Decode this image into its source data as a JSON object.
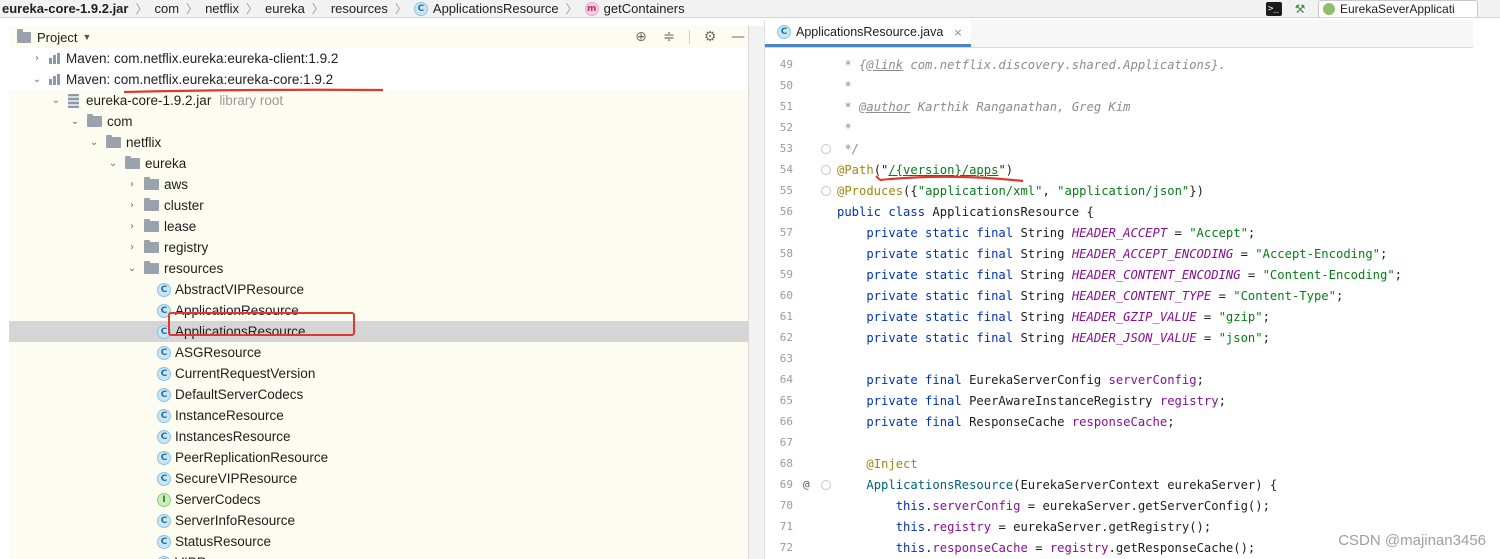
{
  "breadcrumb": [
    {
      "label": "eureka-core-1.9.2.jar",
      "icon": ""
    },
    {
      "label": "com",
      "icon": ""
    },
    {
      "label": "netflix",
      "icon": ""
    },
    {
      "label": "eureka",
      "icon": ""
    },
    {
      "label": "resources",
      "icon": ""
    },
    {
      "label": "ApplicationsResource",
      "icon": "class-icon"
    },
    {
      "label": "getContainers",
      "icon": "method-icon"
    }
  ],
  "toolbar": {
    "run_config": "EurekaSeverApplicati",
    "terminal_glyph": ">_",
    "build_glyph": "⚒"
  },
  "project_panel": {
    "title": "Project",
    "tools": [
      "target-icon",
      "collapse-icon",
      "gear-icon",
      "minimize-icon"
    ],
    "tree": [
      {
        "label": "Maven: com.netflix.eureka:eureka-client:1.9.2",
        "icon": "maven",
        "arrow": "›",
        "level": 1
      },
      {
        "label": "Maven: com.netflix.eureka:eureka-core:1.9.2",
        "icon": "maven",
        "arrow": "⌄",
        "level": 1
      },
      {
        "label": "eureka-core-1.9.2.jar",
        "suffix": "library root",
        "icon": "jar",
        "arrow": "⌄",
        "level": 2
      },
      {
        "label": "com",
        "icon": "folder",
        "arrow": "⌄",
        "level": 3
      },
      {
        "label": "netflix",
        "icon": "folder",
        "arrow": "⌄",
        "level": 4
      },
      {
        "label": "eureka",
        "icon": "folder",
        "arrow": "⌄",
        "level": 5
      },
      {
        "label": "aws",
        "icon": "folder",
        "arrow": "›",
        "level": 6
      },
      {
        "label": "cluster",
        "icon": "folder",
        "arrow": "›",
        "level": 6
      },
      {
        "label": "lease",
        "icon": "folder",
        "arrow": "›",
        "level": 6
      },
      {
        "label": "registry",
        "icon": "folder",
        "arrow": "›",
        "level": 6
      },
      {
        "label": "resources",
        "icon": "folder",
        "arrow": "⌄",
        "level": 6
      },
      {
        "label": "AbstractVIPResource",
        "icon": "class",
        "level": 7
      },
      {
        "label": "ApplicationResource",
        "icon": "class",
        "level": 7
      },
      {
        "label": "ApplicationsResource",
        "icon": "class",
        "level": 7,
        "selected": true
      },
      {
        "label": "ASGResource",
        "icon": "class",
        "level": 7
      },
      {
        "label": "CurrentRequestVersion",
        "icon": "class",
        "level": 7
      },
      {
        "label": "DefaultServerCodecs",
        "icon": "class",
        "level": 7
      },
      {
        "label": "InstanceResource",
        "icon": "class",
        "level": 7
      },
      {
        "label": "InstancesResource",
        "icon": "class",
        "level": 7
      },
      {
        "label": "PeerReplicationResource",
        "icon": "class",
        "level": 7
      },
      {
        "label": "SecureVIPResource",
        "icon": "class",
        "level": 7
      },
      {
        "label": "ServerCodecs",
        "icon": "interface",
        "level": 7
      },
      {
        "label": "ServerInfoResource",
        "icon": "class",
        "level": 7
      },
      {
        "label": "StatusResource",
        "icon": "class",
        "level": 7
      },
      {
        "label": "VIPResource",
        "icon": "class",
        "level": 7
      }
    ]
  },
  "editor": {
    "tab": {
      "label": "ApplicationsResource.java",
      "close": "×"
    },
    "lines": [
      {
        "n": "49",
        "tokens": [
          [
            " * ",
            "cmt"
          ],
          [
            "{",
            "cmt"
          ],
          [
            "@link",
            "doctag"
          ],
          [
            " com.netflix.discovery.shared.Applications}.",
            "cmt"
          ]
        ]
      },
      {
        "n": "50",
        "tokens": [
          [
            " *",
            "cmt"
          ]
        ]
      },
      {
        "n": "51",
        "tokens": [
          [
            " * ",
            "cmt"
          ],
          [
            "@author",
            "doctag"
          ],
          [
            " Karthik Ranganathan, Greg Kim",
            "cmt"
          ]
        ]
      },
      {
        "n": "52",
        "tokens": [
          [
            " *",
            "cmt"
          ]
        ]
      },
      {
        "n": "53",
        "tokens": [
          [
            " */",
            "cmt"
          ]
        ],
        "fold": true
      },
      {
        "n": "54",
        "tokens": [
          [
            "@Path",
            "ann"
          ],
          [
            "(\"",
            "ty"
          ],
          [
            "/{version}/apps",
            "pth"
          ],
          [
            "\")",
            "ty"
          ]
        ],
        "fold": true
      },
      {
        "n": "55",
        "tokens": [
          [
            "@Produces",
            "ann"
          ],
          [
            "({",
            "ty"
          ],
          [
            "\"application/xml\"",
            "str"
          ],
          [
            ", ",
            "ty"
          ],
          [
            "\"application/json\"",
            "str"
          ],
          [
            "})",
            "ty"
          ]
        ],
        "fold": true
      },
      {
        "n": "56",
        "tokens": [
          [
            "public class ",
            "kw"
          ],
          [
            "ApplicationsResource {",
            "ty"
          ]
        ]
      },
      {
        "n": "57",
        "tokens": [
          [
            "    private static final ",
            "kw"
          ],
          [
            "String ",
            "ty"
          ],
          [
            "HEADER_ACCEPT",
            "cnst"
          ],
          [
            " = ",
            "ty"
          ],
          [
            "\"Accept\"",
            "str"
          ],
          [
            ";",
            "ty"
          ]
        ]
      },
      {
        "n": "58",
        "tokens": [
          [
            "    private static final ",
            "kw"
          ],
          [
            "String ",
            "ty"
          ],
          [
            "HEADER_ACCEPT_ENCODING",
            "cnst"
          ],
          [
            " = ",
            "ty"
          ],
          [
            "\"Accept-Encoding\"",
            "str"
          ],
          [
            ";",
            "ty"
          ]
        ]
      },
      {
        "n": "59",
        "tokens": [
          [
            "    private static final ",
            "kw"
          ],
          [
            "String ",
            "ty"
          ],
          [
            "HEADER_CONTENT_ENCODING",
            "cnst"
          ],
          [
            " = ",
            "ty"
          ],
          [
            "\"Content-Encoding\"",
            "str"
          ],
          [
            ";",
            "ty"
          ]
        ]
      },
      {
        "n": "60",
        "tokens": [
          [
            "    private static final ",
            "kw"
          ],
          [
            "String ",
            "ty"
          ],
          [
            "HEADER_CONTENT_TYPE",
            "cnst"
          ],
          [
            " = ",
            "ty"
          ],
          [
            "\"Content-Type\"",
            "str"
          ],
          [
            ";",
            "ty"
          ]
        ]
      },
      {
        "n": "61",
        "tokens": [
          [
            "    private static final ",
            "kw"
          ],
          [
            "String ",
            "ty"
          ],
          [
            "HEADER_GZIP_VALUE",
            "cnst"
          ],
          [
            " = ",
            "ty"
          ],
          [
            "\"gzip\"",
            "str"
          ],
          [
            ";",
            "ty"
          ]
        ]
      },
      {
        "n": "62",
        "tokens": [
          [
            "    private static final ",
            "kw"
          ],
          [
            "String ",
            "ty"
          ],
          [
            "HEADER_JSON_VALUE",
            "cnst"
          ],
          [
            " = ",
            "ty"
          ],
          [
            "\"json\"",
            "str"
          ],
          [
            ";",
            "ty"
          ]
        ]
      },
      {
        "n": "63",
        "tokens": []
      },
      {
        "n": "64",
        "tokens": [
          [
            "    private final ",
            "kw"
          ],
          [
            "EurekaServerConfig ",
            "ty"
          ],
          [
            "serverConfig",
            "fld"
          ],
          [
            ";",
            "ty"
          ]
        ]
      },
      {
        "n": "65",
        "tokens": [
          [
            "    private final ",
            "kw"
          ],
          [
            "PeerAwareInstanceRegistry ",
            "ty"
          ],
          [
            "registry",
            "fld"
          ],
          [
            ";",
            "ty"
          ]
        ]
      },
      {
        "n": "66",
        "tokens": [
          [
            "    private final ",
            "kw"
          ],
          [
            "ResponseCache ",
            "ty"
          ],
          [
            "responseCache",
            "fld"
          ],
          [
            ";",
            "ty"
          ]
        ]
      },
      {
        "n": "67",
        "tokens": []
      },
      {
        "n": "68",
        "tokens": [
          [
            "    ",
            "ty"
          ],
          [
            "@Inject",
            "ann"
          ]
        ]
      },
      {
        "n": "69",
        "tokens": [
          [
            "    ",
            "ty"
          ],
          [
            "ApplicationsResource",
            "mth"
          ],
          [
            "(EurekaServerContext eurekaServer) {",
            "ty"
          ]
        ],
        "at": "@",
        "fold": true
      },
      {
        "n": "70",
        "tokens": [
          [
            "        ",
            "ty"
          ],
          [
            "this",
            "kw"
          ],
          [
            ".",
            "ty"
          ],
          [
            "serverConfig",
            "fld"
          ],
          [
            " = eurekaServer.getServerConfig();",
            "ty"
          ]
        ]
      },
      {
        "n": "71",
        "tokens": [
          [
            "        ",
            "ty"
          ],
          [
            "this",
            "kw"
          ],
          [
            ".",
            "ty"
          ],
          [
            "registry",
            "fld"
          ],
          [
            " = eurekaServer.getRegistry();",
            "ty"
          ]
        ]
      },
      {
        "n": "72",
        "tokens": [
          [
            "        ",
            "ty"
          ],
          [
            "this",
            "kw"
          ],
          [
            ".",
            "ty"
          ],
          [
            "responseCache",
            "fld"
          ],
          [
            " = ",
            "ty"
          ],
          [
            "registry",
            "fld"
          ],
          [
            ".getResponseCache();",
            "ty"
          ]
        ]
      }
    ]
  },
  "watermark": "CSDN @majinan3456",
  "colors": {
    "annotation_red": "#e0392b",
    "selection": "#d5d5d5",
    "panel_bg": "#fcfcf1"
  }
}
